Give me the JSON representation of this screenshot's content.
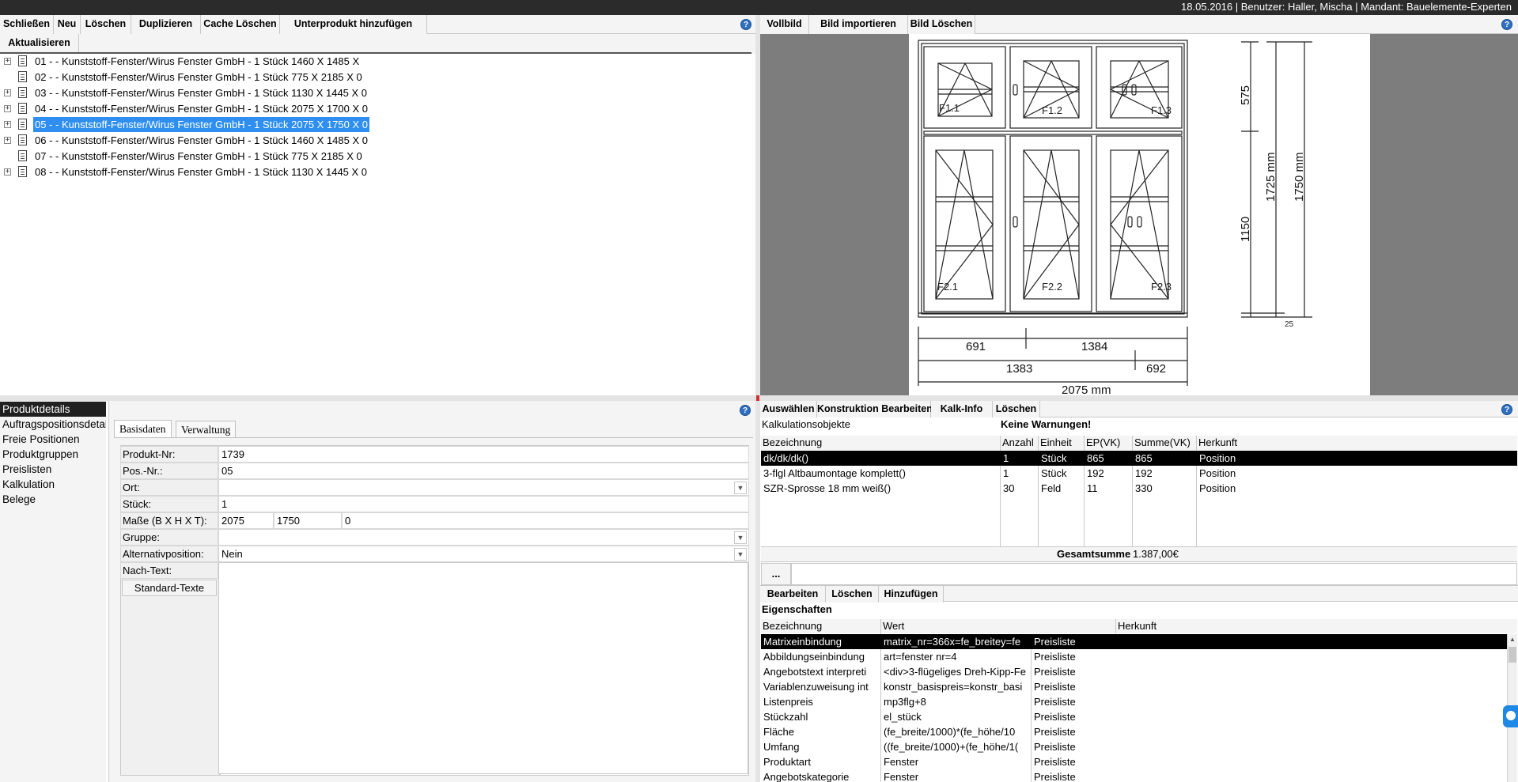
{
  "status_bar": "18.05.2016 | Benutzer: Haller, Mischa | Mandant: Bauelemente-Experten",
  "toolbar_left": {
    "buttons": [
      "Schließen",
      "Neu",
      "Löschen",
      "Duplizieren",
      "Cache Löschen",
      "Unterprodukt hinzufügen"
    ],
    "refresh": "Aktualisieren"
  },
  "toolbar_image": {
    "buttons": [
      "Vollbild",
      "Bild importieren",
      "Bild Löschen"
    ]
  },
  "tree": {
    "items": [
      {
        "label": "01 -  - Kunststoff-Fenster/Wirus Fenster GmbH - 1 Stück 1460 X 1485 X",
        "expandable": true,
        "selected": false
      },
      {
        "label": "02 -  - Kunststoff-Fenster/Wirus Fenster GmbH - 1 Stück 775 X 2185 X 0",
        "expandable": false,
        "selected": false
      },
      {
        "label": "03 -  - Kunststoff-Fenster/Wirus Fenster GmbH - 1 Stück 1130 X 1445 X 0",
        "expandable": true,
        "selected": false
      },
      {
        "label": "04 -  - Kunststoff-Fenster/Wirus Fenster GmbH - 1 Stück 2075 X 1700 X 0",
        "expandable": true,
        "selected": false
      },
      {
        "label": "05 -  - Kunststoff-Fenster/Wirus Fenster GmbH - 1 Stück 2075 X 1750 X 0",
        "expandable": true,
        "selected": true
      },
      {
        "label": "06 -  - Kunststoff-Fenster/Wirus Fenster GmbH - 1 Stück 1460 X 1485 X 0",
        "expandable": true,
        "selected": false
      },
      {
        "label": "07 -  - Kunststoff-Fenster/Wirus Fenster GmbH - 1 Stück 775 X 2185 X 0",
        "expandable": false,
        "selected": false
      },
      {
        "label": "08 -  - Kunststoff-Fenster/Wirus Fenster GmbH - 1 Stück 1130 X 1445 X 0",
        "expandable": true,
        "selected": false
      }
    ]
  },
  "drawing": {
    "panes": [
      "F1.1",
      "F1.2",
      "F1.3",
      "F2.1",
      "F2.2",
      "F2.3"
    ],
    "dims": {
      "top_h": "575",
      "bottom_h": "1150",
      "inner_h": "1725 mm",
      "outer_h": "1750 mm",
      "bottom_gap": "25",
      "w1": "691",
      "w2": "1384",
      "w3": "1383",
      "w4": "692",
      "total_w": "2075 mm"
    }
  },
  "nav": {
    "items": [
      "Produktdetails",
      "Auftragspositionsdetails",
      "Freie Positionen",
      "Produktgruppen",
      "Preislisten",
      "Kalkulation",
      "Belege"
    ],
    "selected_index": 0
  },
  "details": {
    "tabs": [
      "Basisdaten",
      "Verwaltung"
    ],
    "fields": {
      "produkt_nr": {
        "label": "Produkt-Nr:",
        "value": "1739"
      },
      "pos_nr": {
        "label": "Pos.-Nr.:",
        "value": "05"
      },
      "ort": {
        "label": "Ort:",
        "value": ""
      },
      "stueck": {
        "label": "Stück:",
        "value": "1"
      },
      "masse": {
        "label": "Maße (B X H X T):",
        "b": "2075",
        "h": "1750",
        "t": "0"
      },
      "gruppe": {
        "label": "Gruppe:",
        "value": ""
      },
      "alternativ": {
        "label": "Alternativposition:",
        "value": "Nein"
      },
      "nachtext": {
        "label": "Nach-Text:",
        "value": ""
      }
    },
    "standard_button": "Standard-Texte"
  },
  "calc": {
    "toolbar": [
      "Auswählen",
      "Konstruktion Bearbeiten",
      "Kalk-Info",
      "Löschen"
    ],
    "section_label": "Kalkulationsobjekte",
    "warning": "Keine Warnungen!",
    "columns": [
      "Bezeichnung",
      "Anzahl",
      "Einheit",
      "EP(VK)",
      "Summe(VK)",
      "Herkunft"
    ],
    "rows": [
      {
        "cells": [
          "dk/dk/dk()",
          "1",
          "Stück",
          "865",
          "865",
          "Position"
        ],
        "selected": true
      },
      {
        "cells": [
          "3-flgl Altbaumontage komplett()",
          "1",
          "Stück",
          "192",
          "192",
          "Position"
        ],
        "selected": false
      },
      {
        "cells": [
          "SZR-Sprosse 18 mm weiß()",
          "30",
          "Feld",
          "11",
          "330",
          "Position"
        ],
        "selected": false
      }
    ],
    "total_label": "Gesamtsumme",
    "total_value": "1.387,00€",
    "more_button": "..."
  },
  "props": {
    "toolbar": [
      "Bearbeiten",
      "Löschen",
      "Hinzufügen"
    ],
    "section_label": "Eigenschaften",
    "columns": [
      "Bezeichnung",
      "Wert",
      "Herkunft"
    ],
    "rows": [
      {
        "cells": [
          "Matrixeinbindung",
          "matrix_nr=366x=fe_breitey=fe",
          "Preisliste"
        ],
        "selected": true
      },
      {
        "cells": [
          "Abbildungseinbindung",
          "art=fenster nr=4",
          "Preisliste"
        ],
        "selected": false
      },
      {
        "cells": [
          "Angebotstext interpreti",
          "<div>3-flügeliges Dreh-Kipp-Fe",
          "Preisliste"
        ],
        "selected": false
      },
      {
        "cells": [
          "Variablenzuweisung int",
          "konstr_basispreis=konstr_basi",
          "Preisliste"
        ],
        "selected": false
      },
      {
        "cells": [
          "Listenpreis",
          "mp3flg+8",
          "Preisliste"
        ],
        "selected": false
      },
      {
        "cells": [
          "Stückzahl",
          "el_stück",
          "Preisliste"
        ],
        "selected": false
      },
      {
        "cells": [
          "Fläche",
          "(fe_breite/1000)*(fe_höhe/10",
          "Preisliste"
        ],
        "selected": false
      },
      {
        "cells": [
          "Umfang",
          "((fe_breite/1000)+(fe_höhe/1(",
          "Preisliste"
        ],
        "selected": false
      },
      {
        "cells": [
          "Produktart",
          "Fenster",
          "Preisliste"
        ],
        "selected": false
      },
      {
        "cells": [
          "Angebotskategorie",
          "Fenster",
          "Preisliste"
        ],
        "selected": false
      }
    ]
  },
  "colors": {
    "selection": "#2f8ff0",
    "dark_selection": "#000000",
    "help": "#2f6fc2"
  }
}
